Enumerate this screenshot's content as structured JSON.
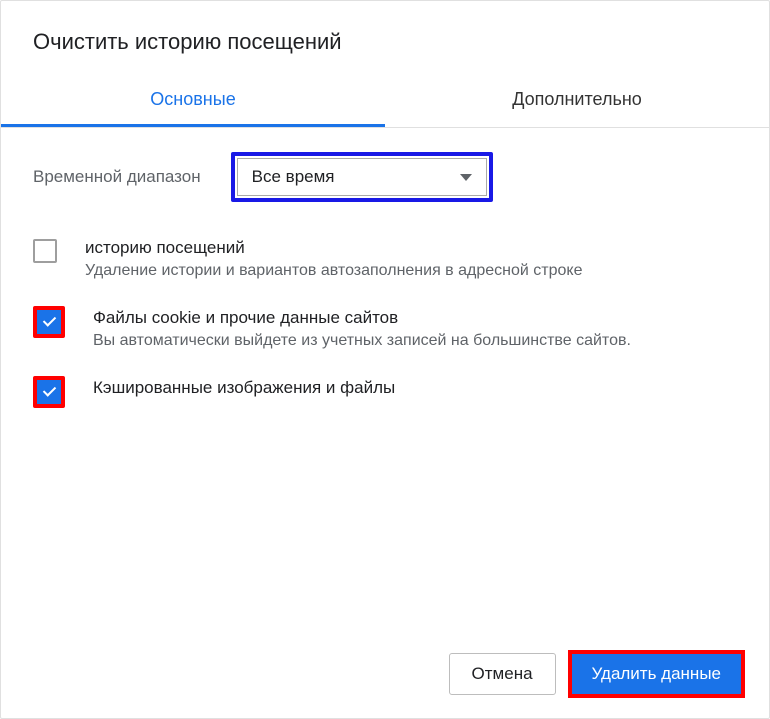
{
  "dialog": {
    "title": "Очистить историю посещений"
  },
  "tabs": {
    "basic": "Основные",
    "advanced": "Дополнительно"
  },
  "time_range": {
    "label": "Временной диапазон",
    "selected": "Все время"
  },
  "options": [
    {
      "checked": false,
      "title": "историю посещений",
      "desc": "Удаление истории и вариантов автозаполнения в адресной строке"
    },
    {
      "checked": true,
      "title": "Файлы cookie и прочие данные сайтов",
      "desc": "Вы автоматически выйдете из учетных записей на большинстве сайтов."
    },
    {
      "checked": true,
      "title": "Кэшированные изображения и файлы",
      "desc": ""
    }
  ],
  "buttons": {
    "cancel": "Отмена",
    "confirm": "Удалить данные"
  }
}
